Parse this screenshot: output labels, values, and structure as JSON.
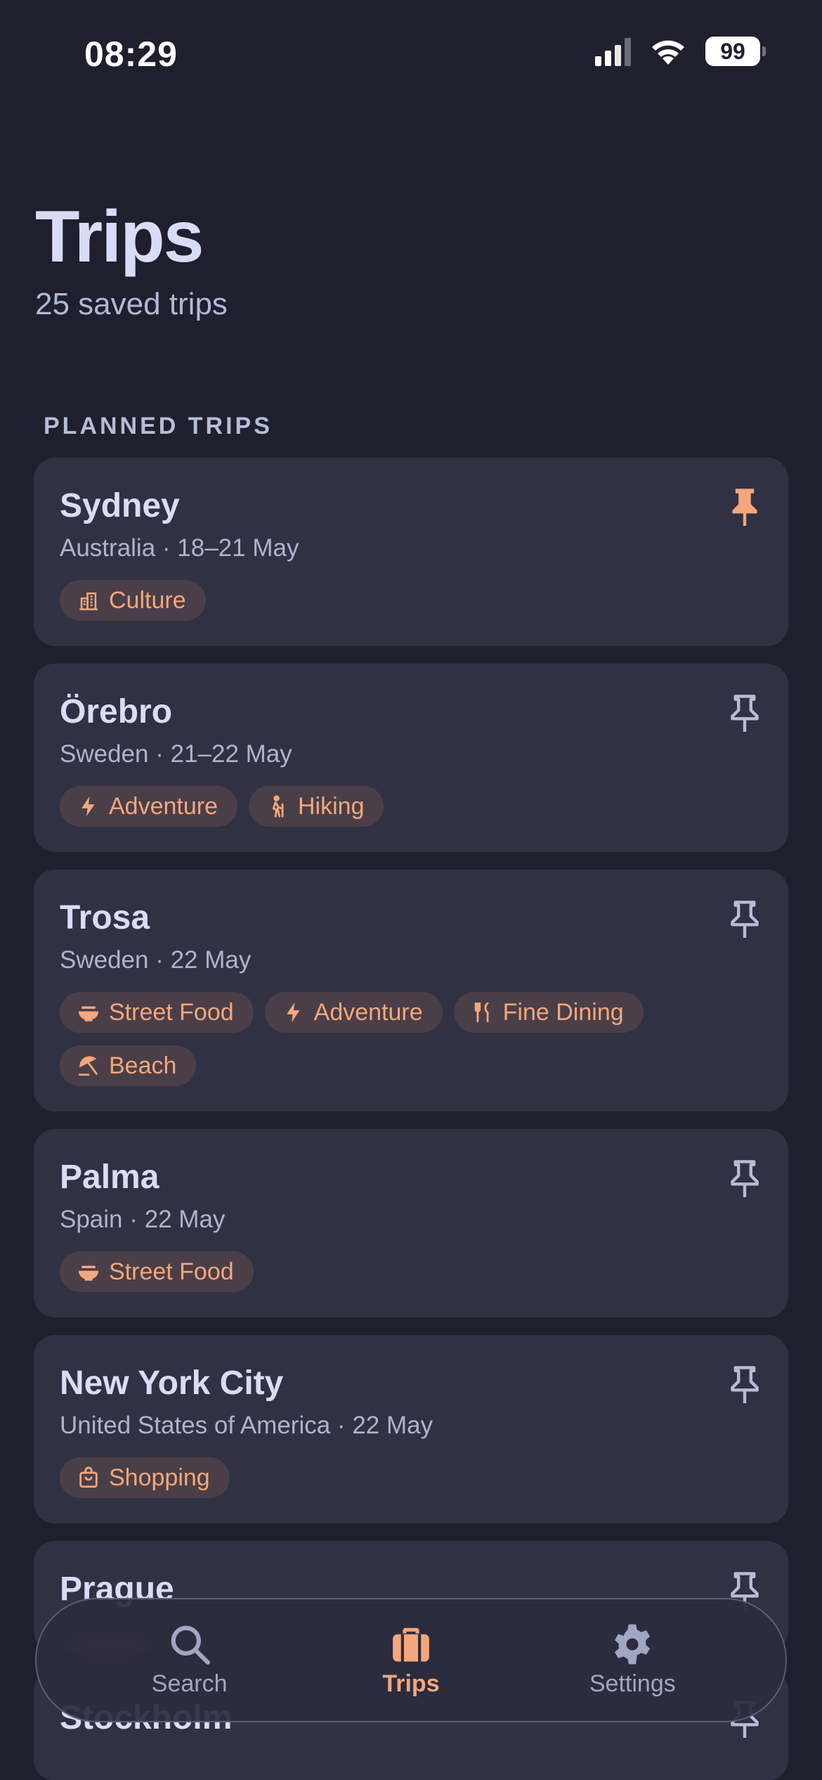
{
  "status": {
    "time": "08:29",
    "battery": "99"
  },
  "header": {
    "title": "Trips",
    "subtitle": "25 saved trips"
  },
  "section": {
    "label": "PLANNED TRIPS"
  },
  "trips": [
    {
      "name": "Sydney",
      "country": "Australia",
      "dates": "18–21 May",
      "pinned": true,
      "tags": [
        {
          "label": "Culture",
          "icon": "building-icon"
        }
      ]
    },
    {
      "name": "Örebro",
      "country": "Sweden",
      "dates": "21–22 May",
      "pinned": false,
      "tags": [
        {
          "label": "Adventure",
          "icon": "bolt-icon"
        },
        {
          "label": "Hiking",
          "icon": "hiker-icon"
        }
      ]
    },
    {
      "name": "Trosa",
      "country": "Sweden",
      "dates": "22 May",
      "pinned": false,
      "tags": [
        {
          "label": "Street Food",
          "icon": "bowl-icon"
        },
        {
          "label": "Adventure",
          "icon": "bolt-icon"
        },
        {
          "label": "Fine Dining",
          "icon": "utensils-icon"
        },
        {
          "label": "Beach",
          "icon": "umbrella-icon"
        }
      ]
    },
    {
      "name": "Palma",
      "country": "Spain",
      "dates": "22 May",
      "pinned": false,
      "tags": [
        {
          "label": "Street Food",
          "icon": "bowl-icon"
        }
      ]
    },
    {
      "name": "New York City",
      "country": "United States of America",
      "dates": "22 May",
      "pinned": false,
      "tags": [
        {
          "label": "Shopping",
          "icon": "bag-icon"
        }
      ]
    },
    {
      "name": "Prague",
      "country": "",
      "dates": "",
      "pinned": false,
      "tags": []
    },
    {
      "name": "Stockholm",
      "country": "",
      "dates": "",
      "pinned": false,
      "tags": []
    }
  ],
  "tabbar": {
    "items": [
      {
        "label": "Search",
        "icon": "search-icon",
        "active": false
      },
      {
        "label": "Trips",
        "icon": "suitcase-icon",
        "active": true
      },
      {
        "label": "Settings",
        "icon": "gear-icon",
        "active": false
      }
    ]
  },
  "colors": {
    "background": "#1f1f2e",
    "card": "#313144",
    "accent": "#f4a77c",
    "tag_bg": "#4a3f48"
  }
}
